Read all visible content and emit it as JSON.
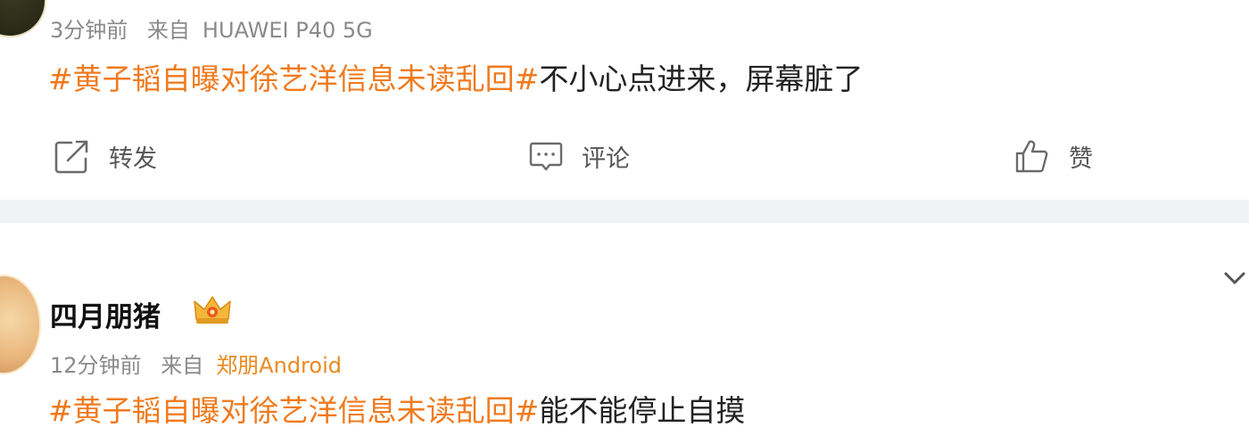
{
  "post1": {
    "time": "3分钟前",
    "source_prefix": "来自",
    "source": "HUAWEI P40 5G",
    "topic": "#黄子韬自曝对徐艺洋信息未读乱回#",
    "text": "不小心点进来，屏幕脏了",
    "actions": {
      "repost_label": "转发",
      "comment_label": "评论",
      "like_label": "赞"
    }
  },
  "post2": {
    "username": "四月朋猪",
    "time": "12分钟前",
    "source_prefix": "来自",
    "source": "郑朋Android",
    "topic": "#黄子韬自曝对徐艺洋信息未读乱回#",
    "text": "能不能停止自摸"
  },
  "colors": {
    "topic": "#f07a1e",
    "source_highlight": "#e98a20",
    "meta": "#8a8a8a",
    "separator": "#f1f2f5"
  },
  "icons": [
    "repost-icon",
    "comment-icon",
    "like-icon",
    "crown-badge-icon",
    "chevron-down-icon"
  ]
}
